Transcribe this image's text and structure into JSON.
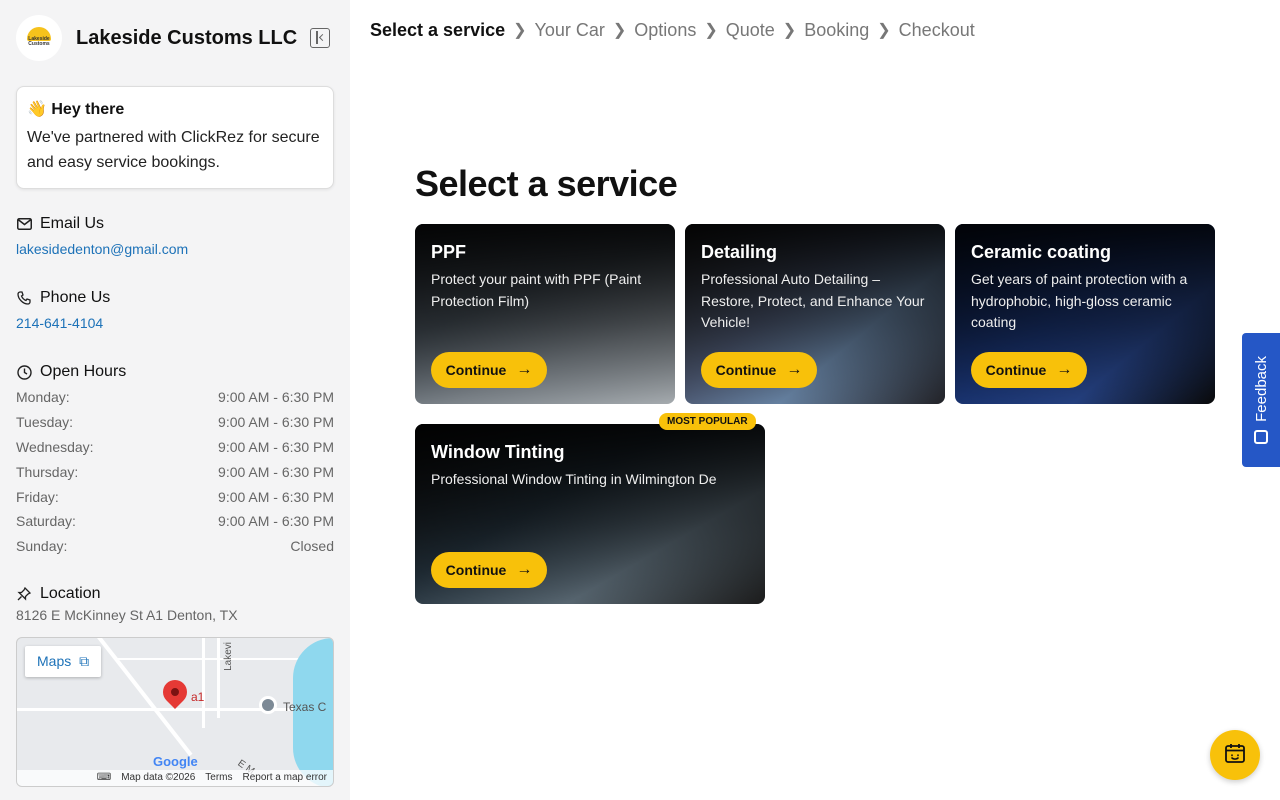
{
  "brand": {
    "name": "Lakeside Customs LLC",
    "logo_text": "Lakeside Customs"
  },
  "greeting": {
    "title": "👋 Hey there",
    "body": "We've partnered with ClickRez for secure and easy service bookings."
  },
  "contact": {
    "email_heading": "Email Us",
    "email": "lakesidedenton@gmail.com",
    "phone_heading": "Phone Us",
    "phone": "214-641-4104"
  },
  "hours": {
    "heading": "Open Hours",
    "rows": [
      {
        "day": "Monday:",
        "time": "9:00 AM - 6:30 PM"
      },
      {
        "day": "Tuesday:",
        "time": "9:00 AM - 6:30 PM"
      },
      {
        "day": "Wednesday:",
        "time": "9:00 AM - 6:30 PM"
      },
      {
        "day": "Thursday:",
        "time": "9:00 AM - 6:30 PM"
      },
      {
        "day": "Friday:",
        "time": "9:00 AM - 6:30 PM"
      },
      {
        "day": "Saturday:",
        "time": "9:00 AM - 6:30 PM"
      },
      {
        "day": "Sunday:",
        "time": "Closed"
      }
    ]
  },
  "location": {
    "heading": "Location",
    "address": "8126 E McKinney St A1 Denton, TX",
    "map": {
      "maps_button": "Maps",
      "pin_label": "a1",
      "poi_label": "Texas C",
      "road_label": "Lakevi",
      "road_label_2": "E M",
      "google": "Google",
      "footer": [
        "Map data ©2026",
        "Terms",
        "Report a map error"
      ]
    }
  },
  "breadcrumbs": [
    "Select a service",
    "Your Car",
    "Options",
    "Quote",
    "Booking",
    "Checkout"
  ],
  "page_title": "Select a service",
  "services": [
    {
      "title": "PPF",
      "description": "Protect your paint with PPF (Paint Protection Film)",
      "button": "Continue"
    },
    {
      "title": "Detailing",
      "description": "Professional Auto Detailing – Restore, Protect, and Enhance Your Vehicle!",
      "button": "Continue"
    },
    {
      "title": "Ceramic coating",
      "description": "Get years of paint protection with a hydrophobic, high-gloss ceramic coating",
      "button": "Continue"
    },
    {
      "title": "Window Tinting",
      "description": "Professional Window Tinting in Wilmington De",
      "button": "Continue",
      "badge": "MOST POPULAR"
    }
  ],
  "feedback_label": "Feedback",
  "colors": {
    "accent": "#f8c10a",
    "link": "#1d72b8",
    "feedback": "#2557c6"
  }
}
